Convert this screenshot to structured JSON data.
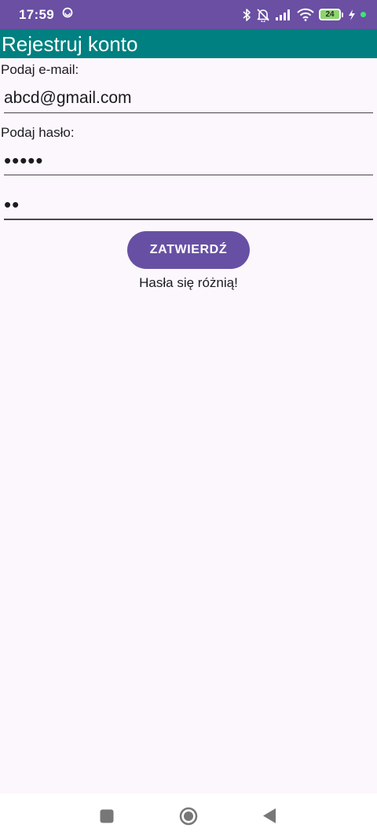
{
  "status_bar": {
    "time": "17:59",
    "battery_level": "24",
    "icons": [
      "sync-icon",
      "bluetooth-icon",
      "muted-bell-icon",
      "signal-icon",
      "wifi-icon",
      "battery-icon",
      "charging-icon"
    ]
  },
  "app_bar": {
    "title": "Rejestruj konto"
  },
  "form": {
    "email_label": "Podaj e-mail:",
    "email_value": "abcd@gmail.com",
    "password_label": "Podaj hasło:",
    "password_value": "•••••",
    "password_confirm_value": "••",
    "submit_label": "ZATWIERDŹ",
    "error_message": "Hasła się różnią!"
  },
  "colors": {
    "status_bar": "#6a4fa2",
    "app_bar": "#008080",
    "button": "#6750a4",
    "background": "#fcf7fc"
  },
  "nav_bar": {
    "icons": [
      "recents-icon",
      "home-icon",
      "back-icon"
    ]
  }
}
